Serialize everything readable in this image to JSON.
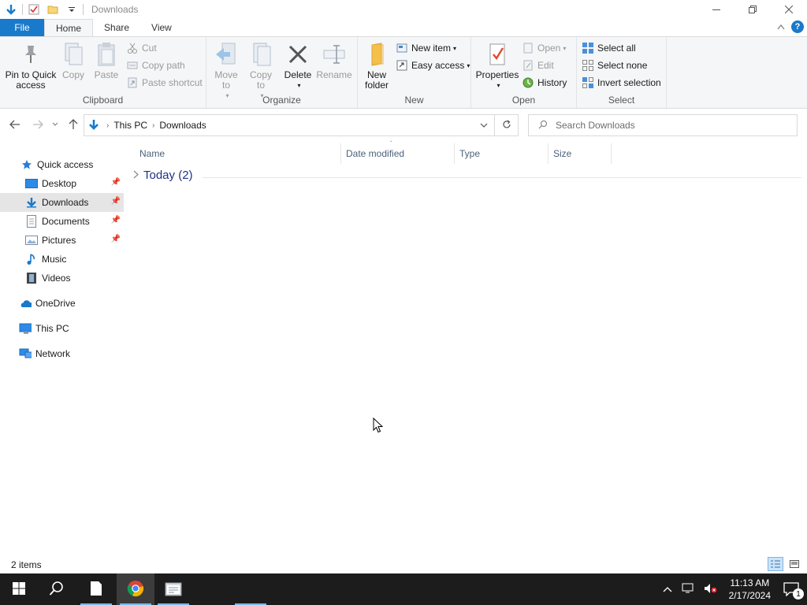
{
  "window": {
    "title": "Downloads",
    "controls": [
      "—",
      "❐",
      "✕"
    ]
  },
  "ribbon_tabs": {
    "file": "File",
    "home": "Home",
    "share": "Share",
    "view": "View"
  },
  "ribbon": {
    "clipboard": {
      "label": "Clipboard",
      "pin": "Pin to Quick access",
      "copy": "Copy",
      "paste": "Paste",
      "cut": "Cut",
      "copy_path": "Copy path",
      "paste_shortcut": "Paste shortcut"
    },
    "organize": {
      "label": "Organize",
      "move_to": "Move to",
      "copy_to": "Copy to",
      "delete": "Delete",
      "rename": "Rename"
    },
    "new": {
      "label": "New",
      "new_folder": "New folder",
      "new_item": "New item",
      "easy_access": "Easy access"
    },
    "open": {
      "label": "Open",
      "properties": "Properties",
      "open": "Open",
      "edit": "Edit",
      "history": "History"
    },
    "select": {
      "label": "Select",
      "select_all": "Select all",
      "select_none": "Select none",
      "invert_selection": "Invert selection"
    }
  },
  "address": {
    "segments": [
      "This PC",
      "Downloads"
    ],
    "search_placeholder": "Search Downloads"
  },
  "nav_pane": {
    "quick_access": "Quick access",
    "desktop": "Desktop",
    "downloads": "Downloads",
    "documents": "Documents",
    "pictures": "Pictures",
    "music": "Music",
    "videos": "Videos",
    "onedrive": "OneDrive",
    "this_pc": "This PC",
    "network": "Network"
  },
  "file_list": {
    "columns": [
      "Name",
      "Date modified",
      "Type",
      "Size"
    ],
    "group": "Today (2)"
  },
  "status": {
    "items": "2 items"
  },
  "taskbar": {
    "time": "11:13 AM",
    "date": "2/17/2024",
    "notification_count": "1"
  },
  "colors": {
    "accent": "#1979ca",
    "taskbar": "#1c1c1c",
    "selected": "#e5e5e5",
    "group_header": "#1e3287"
  }
}
